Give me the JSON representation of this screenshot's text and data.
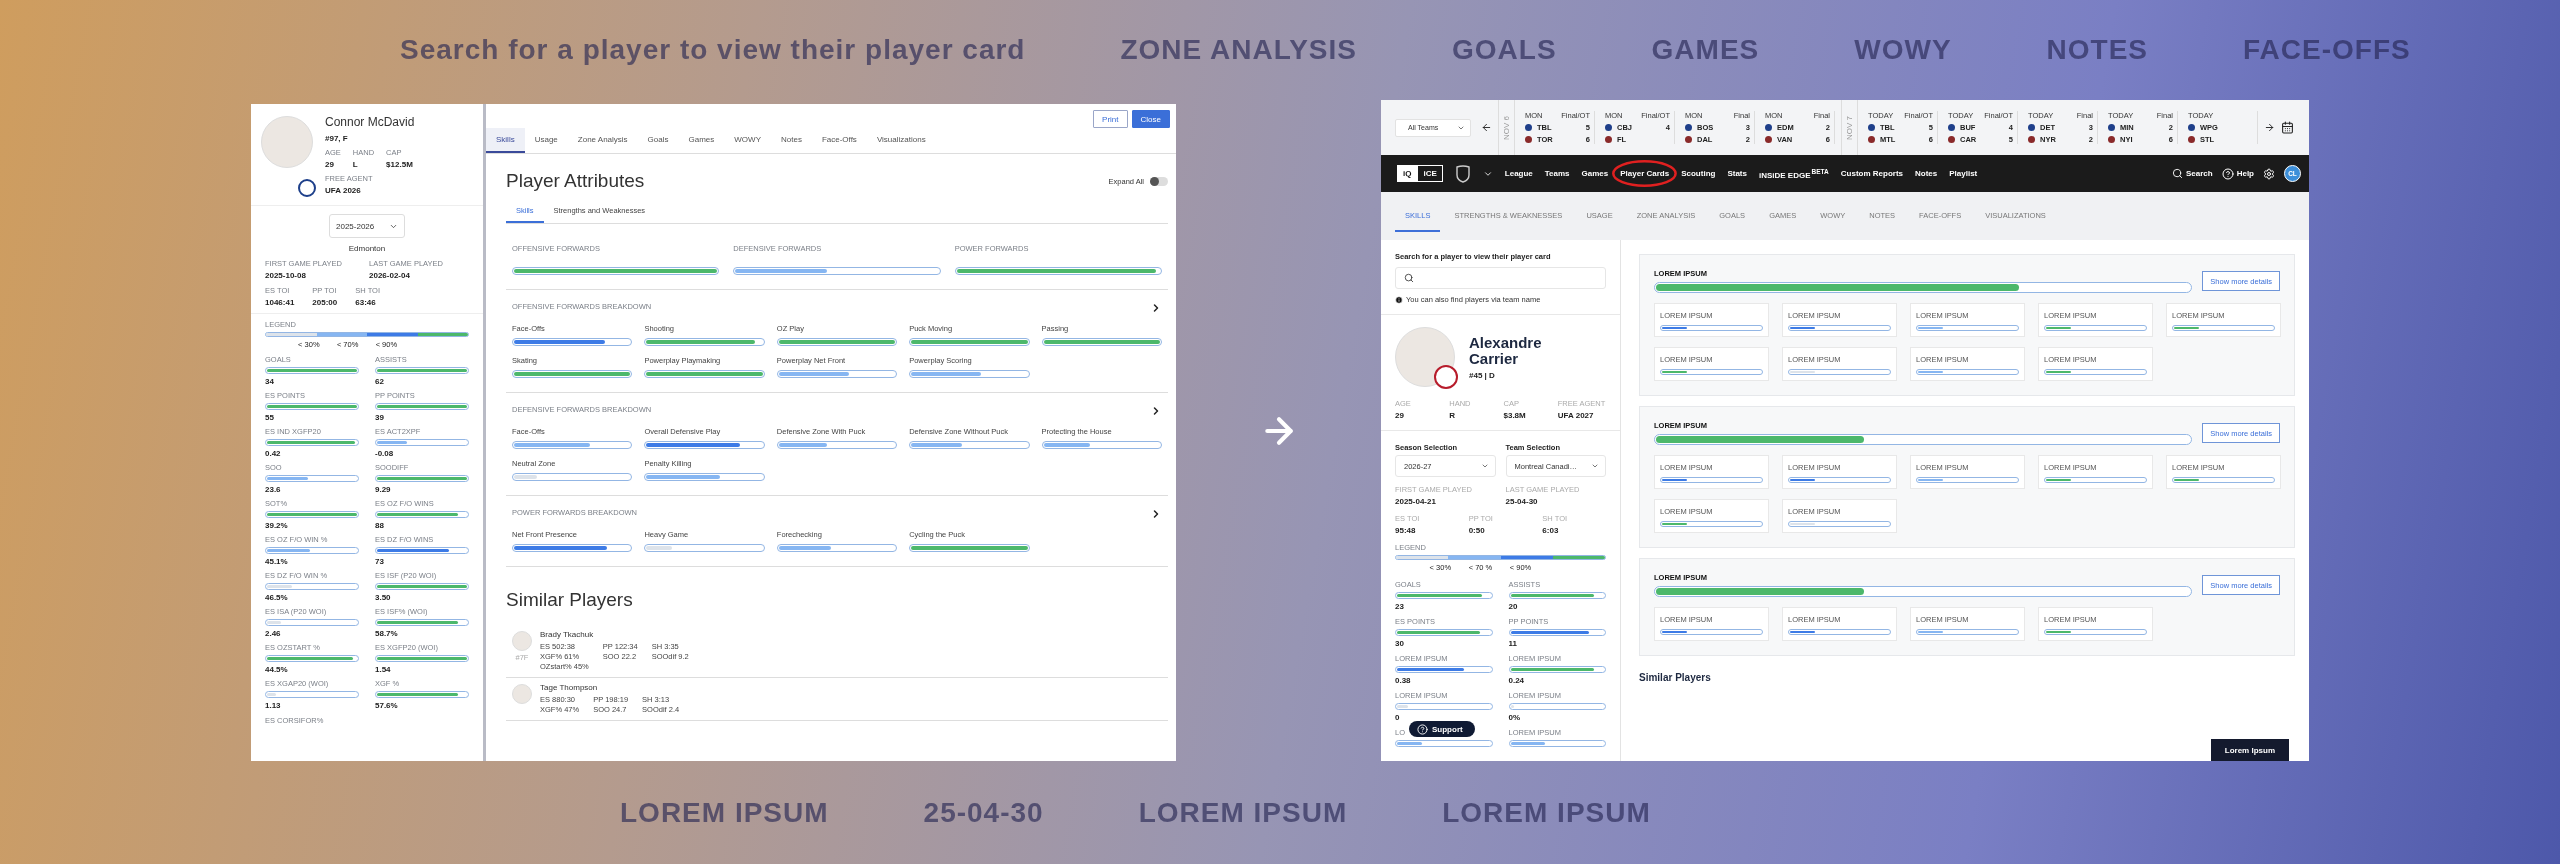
{
  "backdrop": {
    "top_words": [
      "Search for a player to view their player card",
      "ZONE ANALYSIS",
      "GOALS",
      "GAMES",
      "WOWY",
      "NOTES",
      "FACE-OFFS"
    ],
    "bottom_words": [
      "LOREM IPSUM",
      "25-04-30",
      "LOREM IPSUM",
      "LOREM IPSUM"
    ]
  },
  "before_card": {
    "player": {
      "name": "Connor McDavid",
      "number": "#97, F",
      "facts": [
        {
          "label": "AGE",
          "value": "29"
        },
        {
          "label": "HAND",
          "value": "L"
        },
        {
          "label": "CAP",
          "value": "$12.5M"
        }
      ],
      "free_agent": {
        "label": "FREE AGENT",
        "value": "UFA 2026"
      }
    },
    "season": "2025-2026",
    "team": "Edmonton",
    "dates": [
      {
        "label": "FIRST GAME PLAYED",
        "value": "2025-10-08"
      },
      {
        "label": "LAST GAME PLAYED",
        "value": "2026-02-04"
      }
    ],
    "toi": [
      {
        "label": "ES TOI",
        "value": "1046:41"
      },
      {
        "label": "PP TOI",
        "value": "205:00"
      },
      {
        "label": "SH TOI",
        "value": "63:46"
      }
    ],
    "legend": {
      "label": "LEGEND",
      "ticks": [
        "< 30%",
        "< 70%",
        "< 90%"
      ],
      "segments": [
        {
          "color": "#dde3ea"
        },
        {
          "color": "#86b6f2"
        },
        {
          "color": "#3d7be6"
        },
        {
          "color": "#4cb86b"
        }
      ]
    },
    "metrics": [
      {
        "label": "GOALS",
        "value": "34",
        "level": 1,
        "color": "#4cb86b"
      },
      {
        "label": "ASSISTS",
        "value": "62",
        "level": 1,
        "color": "#4cb86b"
      },
      {
        "label": "ES POINTS",
        "value": "55",
        "level": 1,
        "color": "#4cb86b"
      },
      {
        "label": "PP POINTS",
        "value": "39",
        "level": 1,
        "color": "#4cb86b"
      },
      {
        "label": "ES IND XGFP20",
        "value": "0.42",
        "level": 0.98,
        "color": "#4cb86b"
      },
      {
        "label": "ES ACT2XPF",
        "value": "-0.08",
        "level": 0.33,
        "color": "#86b6f2"
      },
      {
        "label": "SOO",
        "value": "23.6",
        "level": 0.45,
        "color": "#86b6f2"
      },
      {
        "label": "SOODIFF",
        "value": "9.29",
        "level": 1,
        "color": "#4cb86b"
      },
      {
        "label": "SOT%",
        "value": "39.2%",
        "level": 1,
        "color": "#4cb86b"
      },
      {
        "label": "ES OZ F/O WINS",
        "value": "88",
        "level": 0.9,
        "color": "#4cb86b"
      },
      {
        "label": "ES OZ F/O WIN %",
        "value": "45.1%",
        "level": 0.48,
        "color": "#86b6f2"
      },
      {
        "label": "ES DZ F/O WINS",
        "value": "73",
        "level": 0.8,
        "color": "#3d7be6"
      },
      {
        "label": "ES DZ F/O WIN %",
        "value": "46.5%",
        "level": 0.28,
        "color": "#dde3ea"
      },
      {
        "label": "ES ISF (P20 WOI)",
        "value": "3.50",
        "level": 1,
        "color": "#4cb86b"
      },
      {
        "label": "ES ISA (P20 WOI)",
        "value": "2.46",
        "level": 0.15,
        "color": "#dde3ea"
      },
      {
        "label": "ES ISF% (WOI)",
        "value": "58.7%",
        "level": 0.9,
        "color": "#4cb86b"
      },
      {
        "label": "ES OZSTART %",
        "value": "44.5%",
        "level": 0.95,
        "color": "#4cb86b"
      },
      {
        "label": "ES XGFP20 (WOI)",
        "value": "1.54",
        "level": 1,
        "color": "#4cb86b"
      },
      {
        "label": "ES XGAP20 (WOI)",
        "value": "1.13",
        "level": 0.1,
        "color": "#dde3ea"
      },
      {
        "label": "XGF %",
        "value": "57.6%",
        "level": 0.9,
        "color": "#4cb86b"
      }
    ],
    "cut_label": "ES CORSIFOR%",
    "buttons": [
      {
        "label": "Print",
        "kind": "outline"
      },
      {
        "label": "Close",
        "kind": "primary"
      }
    ],
    "tabs": [
      {
        "label": "Skills",
        "selected": true
      },
      {
        "label": "Usage",
        "selected": false
      },
      {
        "label": "Zone Analysis",
        "selected": false
      },
      {
        "label": "Goals",
        "selected": false
      },
      {
        "label": "Games",
        "selected": false
      },
      {
        "label": "WOWY",
        "selected": false
      },
      {
        "label": "Notes",
        "selected": false
      },
      {
        "label": "Face-Offs",
        "selected": false
      },
      {
        "label": "Visualizations",
        "selected": false
      }
    ],
    "title": "Player Attributes",
    "expand_all": {
      "label": "Expand All",
      "on": false
    },
    "subtabs": [
      {
        "label": "Skills",
        "selected": true
      },
      {
        "label": "Strengths and Weaknesses",
        "selected": false
      }
    ],
    "summary": [
      {
        "label": "OFFENSIVE FORWARDS",
        "level": 1,
        "color": "#4cb86b"
      },
      {
        "label": "DEFENSIVE FORWARDS",
        "level": 0.45,
        "color": "#86b6f2"
      },
      {
        "label": "POWER FORWARDS",
        "level": 0.98,
        "color": "#4cb86b"
      }
    ],
    "breakdowns": [
      {
        "title": "OFFENSIVE FORWARDS BREAKDOWN",
        "skills": [
          {
            "label": "Face-Offs",
            "level": 0.78,
            "color": "#3d7be6"
          },
          {
            "label": "Shooting",
            "level": 0.93,
            "color": "#4cb86b"
          },
          {
            "label": "OZ Play",
            "level": 1,
            "color": "#4cb86b"
          },
          {
            "label": "Puck Moving",
            "level": 1,
            "color": "#4cb86b"
          },
          {
            "label": "Passing",
            "level": 1,
            "color": "#4cb86b"
          },
          {
            "label": "Skating",
            "level": 1,
            "color": "#4cb86b"
          },
          {
            "label": "Powerplay Playmaking",
            "level": 1,
            "color": "#4cb86b"
          },
          {
            "label": "Powerplay Net Front",
            "level": 0.6,
            "color": "#86b6f2"
          },
          {
            "label": "Powerplay Scoring",
            "level": 0.6,
            "color": "#86b6f2"
          }
        ]
      },
      {
        "title": "DEFENSIVE FORWARDS BREAKDOWN",
        "skills": [
          {
            "label": "Face-Offs",
            "level": 0.65,
            "color": "#86b6f2"
          },
          {
            "label": "Overall Defensive Play",
            "level": 0.8,
            "color": "#3d7be6"
          },
          {
            "label": "Defensive Zone With Puck",
            "level": 0.41,
            "color": "#86b6f2"
          },
          {
            "label": "Defensive Zone Without Puck",
            "level": 0.44,
            "color": "#86b6f2"
          },
          {
            "label": "Protecting the House",
            "level": 0.4,
            "color": "#86b6f2"
          },
          {
            "label": "Neutral Zone",
            "level": 0.2,
            "color": "#dde3ea"
          },
          {
            "label": "Penalty Killing",
            "level": 0.63,
            "color": "#86b6f2"
          }
        ]
      },
      {
        "title": "POWER FORWARDS BREAKDOWN",
        "skills": [
          {
            "label": "Net Front Presence",
            "level": 0.8,
            "color": "#3d7be6"
          },
          {
            "label": "Heavy Game",
            "level": 0.22,
            "color": "#dde3ea"
          },
          {
            "label": "Forechecking",
            "level": 0.45,
            "color": "#86b6f2"
          },
          {
            "label": "Cycling the Puck",
            "level": 1,
            "color": "#4cb86b"
          }
        ]
      }
    ],
    "similar": {
      "title": "Similar Players",
      "players": [
        {
          "name": "Brady Tkachuk",
          "number": "#7F",
          "stats": [
            "ES 502:38",
            "PP 122:34",
            "SH 3:35",
            "XGF% 61%",
            "SOO 22.2",
            "SOOdif 9.2",
            "OZstart% 45%"
          ]
        },
        {
          "name": "Tage Thompson",
          "stats": [
            "ES 880:30",
            "PP 198:19",
            "SH 3:13",
            "XGF% 47%",
            "SOO 24.7",
            "SOOdif 2.4"
          ]
        }
      ]
    }
  },
  "after_card": {
    "ticker": {
      "filter": "All Teams",
      "days": [
        {
          "date": "NOV 6",
          "games": [
            {
              "day": "MON",
              "status": "Final/OT",
              "teams": [
                {
                  "abbr": "TBL",
                  "score": "5"
                },
                {
                  "abbr": "TOR",
                  "score": "6"
                }
              ]
            },
            {
              "day": "MON",
              "status": "Final/OT",
              "teams": [
                {
                  "abbr": "CBJ",
                  "score": "4"
                },
                {
                  "abbr": "FL"
                }
              ]
            },
            {
              "day": "MON",
              "status": "Final",
              "teams": [
                {
                  "abbr": "BOS",
                  "score": "3"
                },
                {
                  "abbr": "DAL",
                  "score": "2"
                }
              ]
            },
            {
              "day": "MON",
              "status": "Final",
              "teams": [
                {
                  "abbr": "EDM",
                  "score": "2"
                },
                {
                  "abbr": "VAN",
                  "score": "6"
                }
              ]
            }
          ]
        },
        {
          "date": "NOV 7",
          "games": [
            {
              "day": "TODAY",
              "status": "Final/OT",
              "teams": [
                {
                  "abbr": "TBL",
                  "score": "5"
                },
                {
                  "abbr": "MTL",
                  "score": "6"
                }
              ]
            },
            {
              "day": "TODAY",
              "status": "Final/OT",
              "teams": [
                {
                  "abbr": "BUF",
                  "score": "4"
                },
                {
                  "abbr": "CAR",
                  "score": "5"
                }
              ]
            },
            {
              "day": "TODAY",
              "status": "Final",
              "teams": [
                {
                  "abbr": "DET",
                  "score": "3"
                },
                {
                  "abbr": "NYR",
                  "score": "2"
                }
              ]
            },
            {
              "day": "TODAY",
              "status": "Final",
              "teams": [
                {
                  "abbr": "MIN",
                  "score": "2"
                },
                {
                  "abbr": "NYI",
                  "score": "6"
                }
              ]
            },
            {
              "day": "TODAY",
              "teams": [
                {
                  "abbr": "WPG"
                },
                {
                  "abbr": "STL"
                }
              ]
            }
          ]
        }
      ]
    },
    "nav": {
      "logo": [
        "iQ",
        "iCE"
      ],
      "items": [
        {
          "label": "League",
          "circled": false
        },
        {
          "label": "Teams",
          "circled": false
        },
        {
          "label": "Games",
          "circled": false
        },
        {
          "label": "Player Cards",
          "circled": true
        },
        {
          "label": "Scouting",
          "circled": false
        },
        {
          "label": "Stats",
          "circled": false
        },
        {
          "label": "iNSiDE EDGE",
          "badge": "BETA",
          "circled": false
        },
        {
          "label": "Custom Reports",
          "circled": false
        },
        {
          "label": "Notes",
          "circled": false
        },
        {
          "label": "Playlist",
          "circled": false
        }
      ],
      "search": "Search",
      "help": "Help",
      "avatar": "CL"
    },
    "tabs": [
      {
        "label": "SKILLS",
        "selected": true
      },
      {
        "label": "STRENGTHS & WEAKNESSES",
        "selected": false
      },
      {
        "label": "USAGE",
        "selected": false
      },
      {
        "label": "ZONE ANALYSIS",
        "selected": false
      },
      {
        "label": "GOALS",
        "selected": false
      },
      {
        "label": "GAMES",
        "selected": false
      },
      {
        "label": "WOWY",
        "selected": false
      },
      {
        "label": "NOTES",
        "selected": false
      },
      {
        "label": "FACE-OFFS",
        "selected": false
      },
      {
        "label": "VISUALIZATIONS",
        "selected": false
      }
    ],
    "search_prompt": "Search for a player to view their player card",
    "search_hint": "You can also find players via team name",
    "player": {
      "name": "Alexandre Carrier",
      "number": "#45 | D",
      "facts": [
        {
          "label": "AGE",
          "value": "29"
        },
        {
          "label": "HAND",
          "value": "R"
        },
        {
          "label": "CAP",
          "value": "$3.8M"
        },
        {
          "label": "FREE AGENT",
          "value": "UFA 2027"
        }
      ]
    },
    "selectors": [
      {
        "label": "Season Selection",
        "value": "2026-27"
      },
      {
        "label": "Team Selection",
        "value": "Montreal Canadi…"
      }
    ],
    "dates": [
      {
        "label": "FIRST GAME PLAYED",
        "value": "2025-04-21"
      },
      {
        "label": "LAST GAME PLAYED",
        "value": "25-04-30"
      }
    ],
    "toi": [
      {
        "label": "ES TOI",
        "value": "95:48"
      },
      {
        "label": "PP TOI",
        "value": "0:50"
      },
      {
        "label": "SH TOI",
        "value": "6:03"
      }
    ],
    "legend": {
      "label": "LEGEND",
      "ticks": [
        "< 30%",
        "< 70 %",
        "< 90%"
      ],
      "segments": [
        {
          "color": "#dde3ea"
        },
        {
          "color": "#86b6f2"
        },
        {
          "color": "#3d7be6"
        },
        {
          "color": "#4cb86b"
        }
      ]
    },
    "metrics": [
      {
        "label": "GOALS",
        "value": "23",
        "level": 0.91,
        "color": "#4cb86b"
      },
      {
        "label": "ASSISTS",
        "value": "20",
        "level": 0.89,
        "color": "#4cb86b"
      },
      {
        "label": "ES POINTS",
        "value": "30",
        "level": 0.89,
        "color": "#4cb86b"
      },
      {
        "label": "PP POINTS",
        "value": "11",
        "level": 0.84,
        "color": "#3d7be6"
      },
      {
        "label": "LOREM IPSUM",
        "value": "0.38",
        "level": 0.72,
        "color": "#3d7be6"
      },
      {
        "label": "LOREM IPSUM",
        "value": "0.24",
        "level": 0.89,
        "color": "#4cb86b"
      },
      {
        "label": "LOREM IPSUM",
        "value": "0",
        "level": 0.12,
        "color": "#dde3ea"
      },
      {
        "label": "LOREM IPSUM",
        "value": "0%",
        "level": 0.04,
        "color": "#dde3ea"
      },
      {
        "label": "LO",
        "level": 0.27,
        "color": "#86b6f2"
      },
      {
        "label": "LOREM IPSUM",
        "level": 0.37,
        "color": "#86b6f2"
      }
    ],
    "support": "Support",
    "groups": [
      {
        "title": "LOREM IPSUM",
        "level": 0.68,
        "color": "#4cb86b",
        "button": "Show more details",
        "items": [
          {
            "label": "LOREM IPSUM",
            "level": 0.25,
            "color": "#3d7be6"
          },
          {
            "label": "LOREM IPSUM",
            "level": 0.25,
            "color": "#3d7be6"
          },
          {
            "label": "LOREM IPSUM",
            "level": 0.25,
            "color": "#86b6f2"
          },
          {
            "label": "LOREM IPSUM",
            "level": 0.25,
            "color": "#4cb86b"
          },
          {
            "label": "LOREM IPSUM",
            "level": 0.25,
            "color": "#4cb86b"
          },
          {
            "label": "LOREM IPSUM",
            "level": 0.25,
            "color": "#4cb86b"
          },
          {
            "label": "LOREM IPSUM",
            "level": 0.25,
            "color": "#dde3ea"
          },
          {
            "label": "LOREM IPSUM",
            "level": 0.25,
            "color": "#86b6f2"
          },
          {
            "label": "LOREM IPSUM",
            "level": 0.25,
            "color": "#4cb86b"
          }
        ]
      },
      {
        "title": "LOREM IPSUM",
        "level": 0.39,
        "color": "#4cb86b",
        "button": "Show more details",
        "items": [
          {
            "label": "LOREM IPSUM",
            "level": 0.25,
            "color": "#3d7be6"
          },
          {
            "label": "LOREM IPSUM",
            "level": 0.25,
            "color": "#3d7be6"
          },
          {
            "label": "LOREM IPSUM",
            "level": 0.25,
            "color": "#86b6f2"
          },
          {
            "label": "LOREM IPSUM",
            "level": 0.25,
            "color": "#4cb86b"
          },
          {
            "label": "LOREM IPSUM",
            "level": 0.25,
            "color": "#4cb86b"
          },
          {
            "label": "LOREM IPSUM",
            "level": 0.25,
            "color": "#4cb86b"
          },
          {
            "label": "LOREM IPSUM",
            "level": 0.25,
            "color": "#dde3ea"
          }
        ]
      },
      {
        "title": "LOREM IPSUM",
        "level": 0.39,
        "color": "#4cb86b",
        "button": "Show more details",
        "items": [
          {
            "label": "LOREM IPSUM",
            "level": 0.25,
            "color": "#3d7be6"
          },
          {
            "label": "LOREM IPSUM",
            "level": 0.25,
            "color": "#3d7be6"
          },
          {
            "label": "LOREM IPSUM",
            "level": 0.25,
            "color": "#86b6f2"
          },
          {
            "label": "LOREM IPSUM",
            "level": 0.25,
            "color": "#4cb86b"
          }
        ]
      }
    ],
    "similar_title": "Similar Players",
    "action": "Lorem Ipsum"
  }
}
